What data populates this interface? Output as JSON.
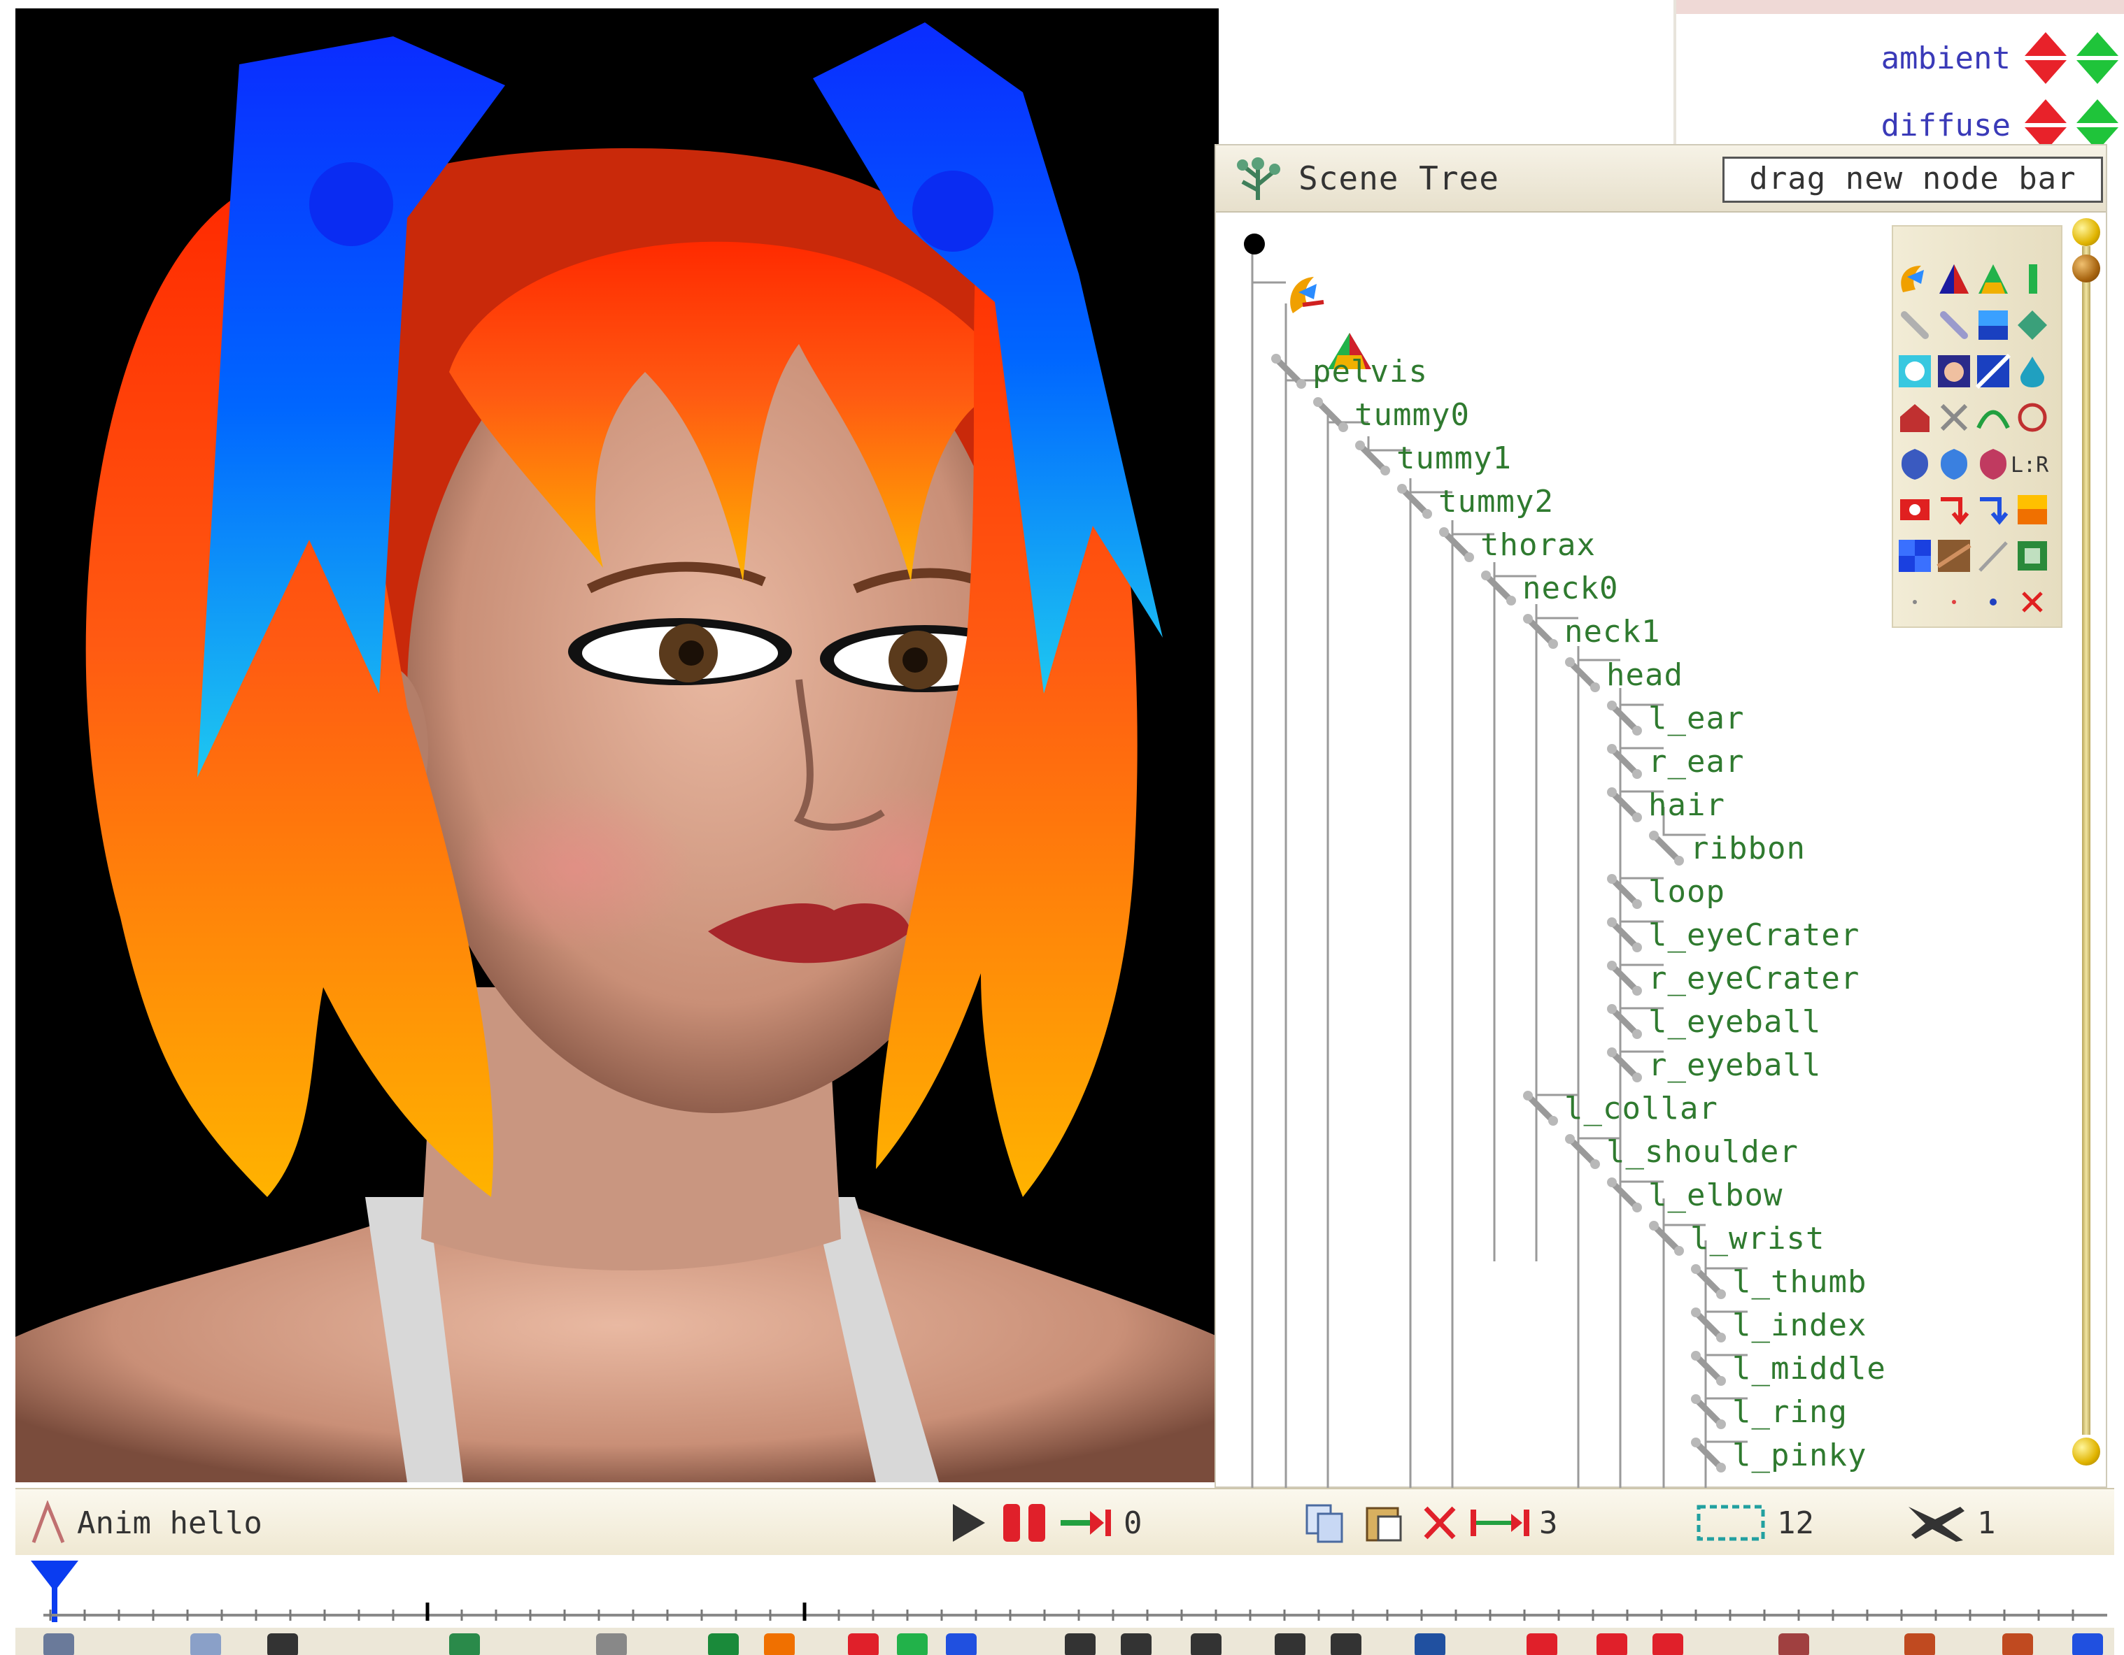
{
  "material": {
    "ambient_label": "ambient",
    "diffuse_label": "diffuse"
  },
  "scene_tree": {
    "title": "Scene Tree",
    "drag_bar_label": "drag new node bar",
    "nodes": [
      "pelvis",
      "tummy0",
      "tummy1",
      "tummy2",
      "thorax",
      "neck0",
      "neck1",
      "head",
      "l_ear",
      "r_ear",
      "hair",
      "ribbon",
      "loop",
      "l_eyeCrater",
      "r_eyeCrater",
      "l_eyeball",
      "r_eyeball",
      "l_collar",
      "l_shoulder",
      "l_elbow",
      "l_wrist",
      "l_thumb",
      "l_index",
      "l_middle",
      "l_ring",
      "l_pinky"
    ]
  },
  "anim_bar": {
    "anim_name": "Anim hello",
    "jump_value": "0",
    "interval_value": "3",
    "frames_value": "12",
    "speed_value": "1"
  },
  "palette": {
    "lr_label": "L:R"
  },
  "colors": {
    "tree_text": "#2f7a2f",
    "panel_bg": "#efe8d2",
    "viewport_bg": "#000000"
  }
}
